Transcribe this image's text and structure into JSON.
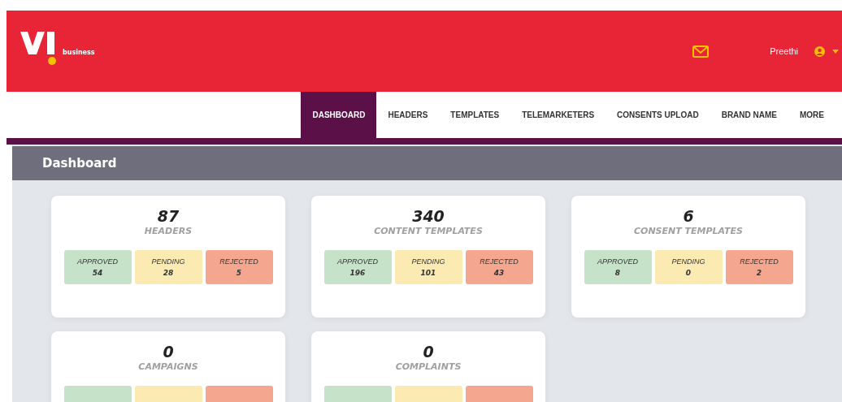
{
  "header": {
    "brand": "business",
    "user": "Preethi"
  },
  "nav": [
    {
      "label": "DASHBOARD",
      "selected": true
    },
    {
      "label": "HEADERS",
      "selected": false
    },
    {
      "label": "TEMPLATES",
      "selected": false
    },
    {
      "label": "TELEMARKETERS",
      "selected": false
    },
    {
      "label": "CONSENTS UPLOAD",
      "selected": false
    },
    {
      "label": "BRAND NAME",
      "selected": false
    },
    {
      "label": "MORE",
      "selected": false
    }
  ],
  "page_title": "Dashboard",
  "cards": [
    {
      "count": "87",
      "title": "HEADERS",
      "stats": [
        {
          "kind": "green",
          "label": "APPROVED",
          "value": "54"
        },
        {
          "kind": "yellow",
          "label": "PENDING",
          "value": "28"
        },
        {
          "kind": "red",
          "label": "REJECTED",
          "value": "5"
        }
      ]
    },
    {
      "count": "340",
      "title": "CONTENT TEMPLATES",
      "stats": [
        {
          "kind": "green",
          "label": "APPROVED",
          "value": "196"
        },
        {
          "kind": "yellow",
          "label": "PENDING",
          "value": "101"
        },
        {
          "kind": "red",
          "label": "REJECTED",
          "value": "43"
        }
      ]
    },
    {
      "count": "6",
      "title": "CONSENT TEMPLATES",
      "stats": [
        {
          "kind": "green",
          "label": "APPROVED",
          "value": "8"
        },
        {
          "kind": "yellow",
          "label": "PENDING",
          "value": "0"
        },
        {
          "kind": "red",
          "label": "REJECTED",
          "value": "2"
        }
      ]
    },
    {
      "count": "0",
      "title": "CAMPAIGNS",
      "stats": [
        {
          "kind": "green"
        },
        {
          "kind": "yellow"
        },
        {
          "kind": "red"
        }
      ]
    },
    {
      "count": "0",
      "title": "COMPLAINTS",
      "stats": [
        {
          "kind": "green"
        },
        {
          "kind": "yellow"
        },
        {
          "kind": "red"
        }
      ]
    }
  ]
}
